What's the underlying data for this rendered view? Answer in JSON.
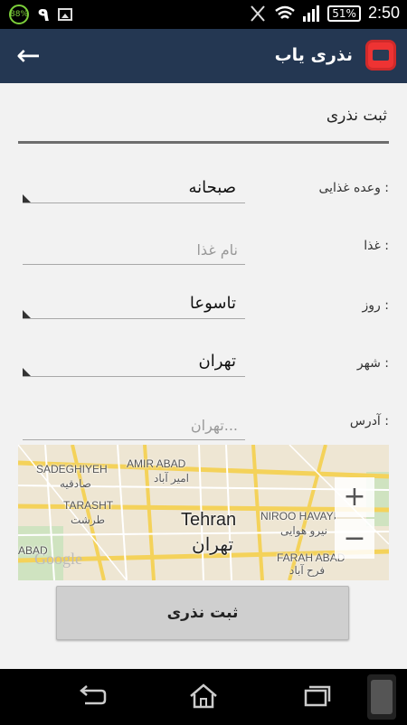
{
  "status_bar": {
    "battery_badge": "88%",
    "notification_digit": "۹",
    "battery_percent": "51%",
    "time": "2:50"
  },
  "app_bar": {
    "title": "نذری یاب",
    "back_icon": "arrow-left-icon",
    "logo_icon": "app-logo-icon"
  },
  "form": {
    "section_title": "ثبت نذری",
    "meal_label": "وعده غذایی :",
    "meal_value": "صبحانه",
    "food_label": "غذا :",
    "food_placeholder": "نام غذا",
    "day_label": "روز :",
    "day_value": "تاسوعا",
    "city_label": "شهر :",
    "city_value": "تهران",
    "address_label": "آدرس :",
    "address_placeholder": "تهران..."
  },
  "map": {
    "labels": {
      "sadeghiyeh_en": "SADEGHIYEH",
      "sadeghiyeh_fa": "صادقیه",
      "amir_abad_en": "AMIR ABAD",
      "amir_abad_fa": "امیر آباد",
      "tarasht_en": "TARASHT",
      "tarasht_fa": "طرشت",
      "tehran_en": "Tehran",
      "tehran_fa": "تهران",
      "niroo_havayi_en": "NIROO HAVAYI",
      "niroo_havayi_fa": "نیرو هوایی",
      "farah_abad_en": "FARAH ABAD",
      "farah_abad_fa": "فرح آباد",
      "abad_partial": "ABAD",
      "google_logo": "Google"
    },
    "zoom_in": "+",
    "zoom_out": "−"
  },
  "submit_label": "ثبت نذری",
  "nav": {
    "back_icon": "back-icon",
    "home_icon": "home-icon",
    "recents_icon": "recents-icon"
  },
  "colors": {
    "app_bar": "#243752",
    "background": "#f2f2f2",
    "button": "#cfcfcf"
  }
}
